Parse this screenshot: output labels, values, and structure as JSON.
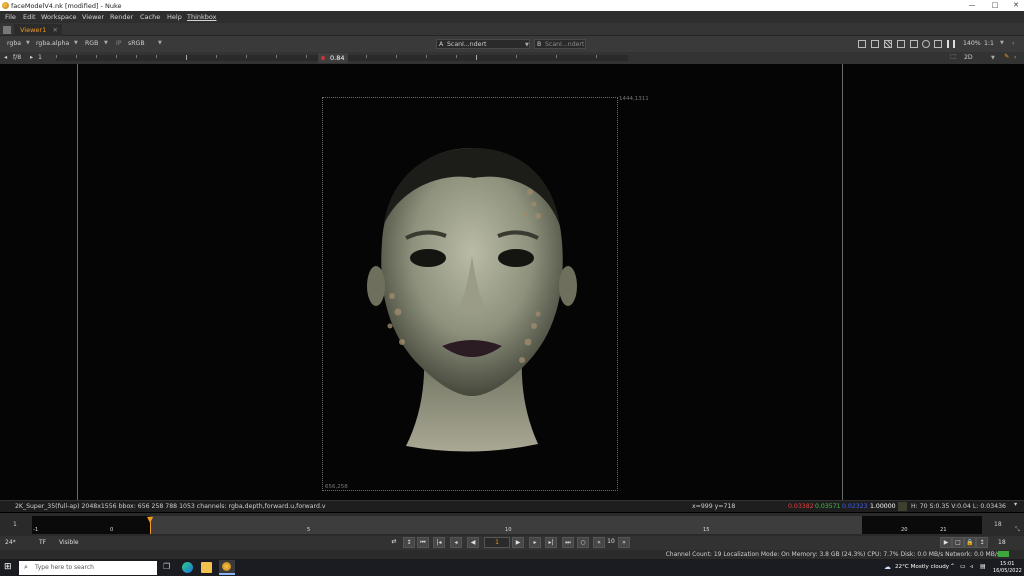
{
  "window": {
    "title": "faceModelV4.nk [modified] - Nuke",
    "controls": [
      "—",
      "□",
      "✕"
    ]
  },
  "menu": [
    "File",
    "Edit",
    "Workspace",
    "Viewer",
    "Render",
    "Cache",
    "Help",
    "Thinkbox"
  ],
  "tab": {
    "label": "Viewer1",
    "close": "✕"
  },
  "viewer_controls": {
    "layer": "rgba",
    "alpha": "rgba.alpha",
    "display": "RGB",
    "ip": "IP",
    "colorspace": "sRGB",
    "input_a_label": "A",
    "input_a": "ScanI...ndert",
    "input_b_label": "B",
    "input_b": "ScanI...ndert",
    "zoom": "140%",
    "ratio": "1:1",
    "fstop": "f/8",
    "frame": "1",
    "gain_value": "0.84",
    "mode": "2D"
  },
  "image": {
    "top_right_label": "1444,1311",
    "bottom_left_label": "656,258"
  },
  "info": {
    "format": "2K_Super_35(full-ap) 2048x1556  bbox: 656 258 788 1053 channels: rgba,depth,forward.u,forward.v",
    "coords": "x=999 y=718",
    "r": "0.03382",
    "g": "0.03571",
    "b": "0.02323",
    "a": "1.00000",
    "hsv": "H: 70 S:0.35 V:0.04  L: 0.03436"
  },
  "timeline": {
    "start": "1",
    "end": "18",
    "labels": [
      "-1",
      "0",
      "5",
      "10",
      "15",
      "20",
      "21"
    ]
  },
  "playback": {
    "fps": "24*",
    "tf": "TF",
    "range": "Visible",
    "current_frame": "1",
    "increment": "10",
    "end_frame": "18"
  },
  "status": "Channel Count: 19  Localization Mode: On  Memory: 3.8 GB (24.3%)  CPU: 7.7%  Disk: 0.0 MB/s  Network: 0.0 MB/s",
  "taskbar": {
    "search_placeholder": "Type here to search",
    "weather": "22°C  Mostly cloudy",
    "time": "15:01",
    "date": "16/05/2022"
  },
  "colors": {
    "accent": "#f39b1e",
    "r": "#e04040",
    "g": "#40c040",
    "b": "#4060e0"
  }
}
